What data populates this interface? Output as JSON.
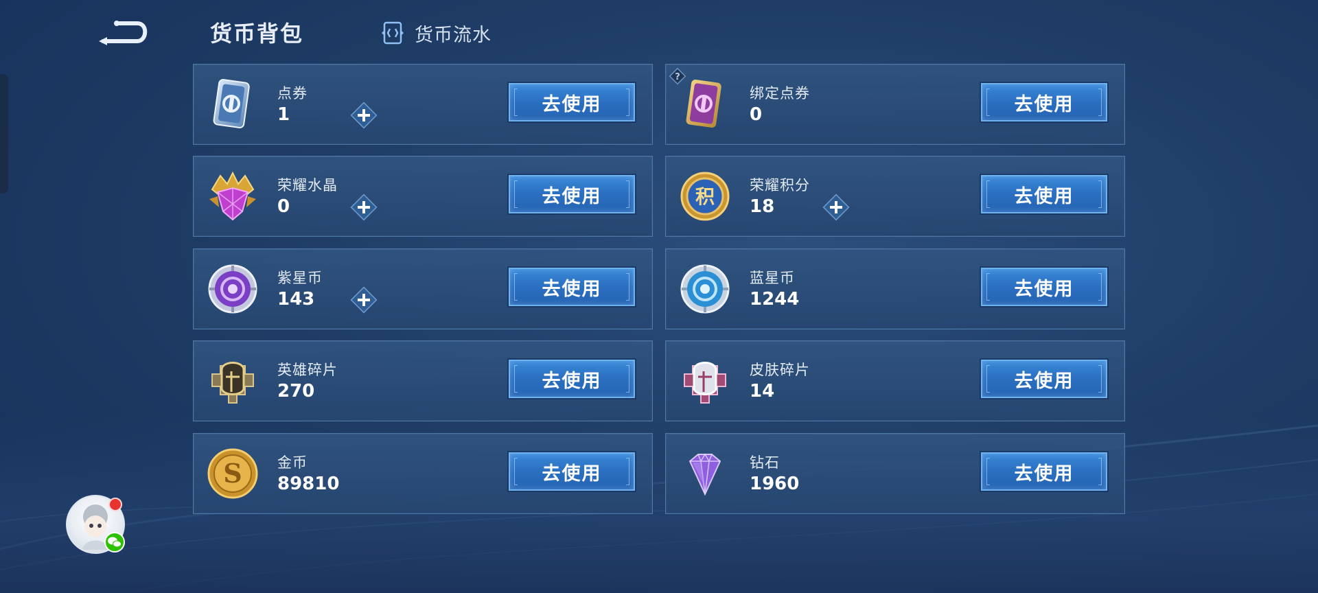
{
  "header": {
    "title": "货币背包",
    "flow_tab_label": "货币流水"
  },
  "buttons": {
    "use_label": "去使用"
  },
  "currencies": [
    {
      "name": "点券",
      "amount": "1",
      "icon": "voucher-card-blue-icon",
      "has_plus": true,
      "has_help": false
    },
    {
      "name": "绑定点券",
      "amount": "0",
      "icon": "bound-voucher-card-purple-icon",
      "has_plus": false,
      "has_help": true
    },
    {
      "name": "荣耀水晶",
      "amount": "0",
      "icon": "glory-crystal-icon",
      "has_plus": true,
      "has_help": false
    },
    {
      "name": "荣耀积分",
      "amount": "18",
      "icon": "glory-points-medal-icon",
      "has_plus": true,
      "has_help": false
    },
    {
      "name": "紫星币",
      "amount": "143",
      "icon": "purple-star-coin-icon",
      "has_plus": true,
      "has_help": false
    },
    {
      "name": "蓝星币",
      "amount": "1244",
      "icon": "blue-star-coin-icon",
      "has_plus": false,
      "has_help": false
    },
    {
      "name": "英雄碎片",
      "amount": "270",
      "icon": "hero-fragment-helmet-icon",
      "has_plus": false,
      "has_help": false
    },
    {
      "name": "皮肤碎片",
      "amount": "14",
      "icon": "skin-fragment-helmet-icon",
      "has_plus": false,
      "has_help": false
    },
    {
      "name": "金币",
      "amount": "89810",
      "icon": "gold-coin-icon",
      "has_plus": false,
      "has_help": false
    },
    {
      "name": "钻石",
      "amount": "1960",
      "icon": "diamond-icon",
      "has_plus": false,
      "has_help": false
    }
  ],
  "colors": {
    "background": "#1f3d66",
    "card": "#30547f",
    "card_border": "#4f78a8",
    "button": "#2b6fc0",
    "button_border": "#6fb2f0",
    "notification": "#e8332f",
    "wechat": "#2dc100"
  }
}
